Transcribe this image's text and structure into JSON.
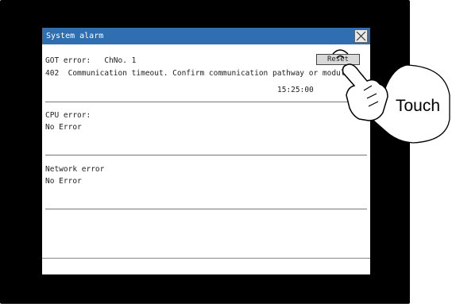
{
  "window": {
    "title": "System alarm",
    "close_icon": "close-icon"
  },
  "got_error": {
    "header": "GOT error:   ChNo. 1",
    "message": "402  Communication timeout. Confirm communication pathway or modules.",
    "time": "15:25:00",
    "reset_label": "Reset"
  },
  "cpu_error": {
    "header": "CPU error:",
    "status": "No Error"
  },
  "network_error": {
    "header": "Network error",
    "status": "No Error"
  },
  "annotation": {
    "label": "Touch",
    "icon": "pointing-hand-icon"
  },
  "colors": {
    "titlebar": "#2f6fb1",
    "bezel": "#000000",
    "button": "#d9d9d9"
  }
}
